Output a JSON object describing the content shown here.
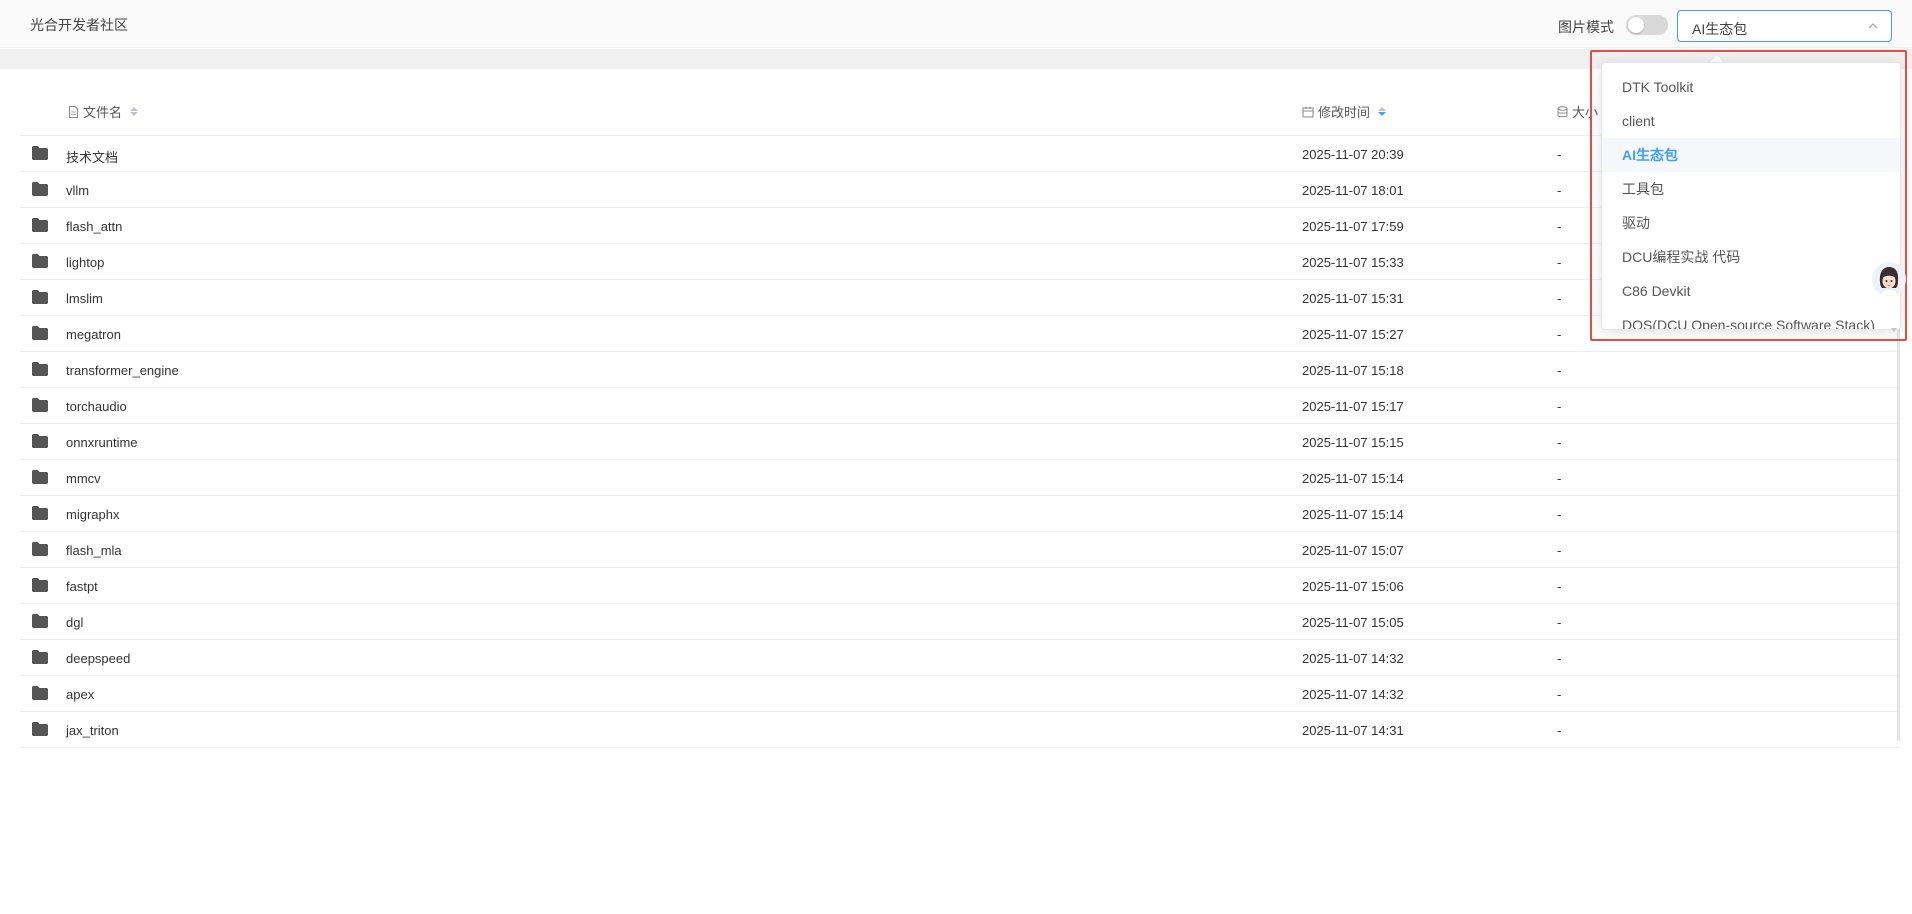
{
  "header": {
    "site_title": "光合开发者社区",
    "picture_mode_label": "图片模式",
    "picture_mode_on": false,
    "selected_category": "AI生态包"
  },
  "table": {
    "columns": {
      "name": "文件名",
      "modified": "修改时间",
      "size": "大小"
    },
    "rows": [
      {
        "name": "技术文档",
        "modified": "2025-11-07 20:39",
        "size": "-"
      },
      {
        "name": "vllm",
        "modified": "2025-11-07 18:01",
        "size": "-"
      },
      {
        "name": "flash_attn",
        "modified": "2025-11-07 17:59",
        "size": "-"
      },
      {
        "name": "lightop",
        "modified": "2025-11-07 15:33",
        "size": "-"
      },
      {
        "name": "lmslim",
        "modified": "2025-11-07 15:31",
        "size": "-"
      },
      {
        "name": "megatron",
        "modified": "2025-11-07 15:27",
        "size": "-"
      },
      {
        "name": "transformer_engine",
        "modified": "2025-11-07 15:18",
        "size": "-"
      },
      {
        "name": "torchaudio",
        "modified": "2025-11-07 15:17",
        "size": "-"
      },
      {
        "name": "onnxruntime",
        "modified": "2025-11-07 15:15",
        "size": "-"
      },
      {
        "name": "mmcv",
        "modified": "2025-11-07 15:14",
        "size": "-"
      },
      {
        "name": "migraphx",
        "modified": "2025-11-07 15:14",
        "size": "-"
      },
      {
        "name": "flash_mla",
        "modified": "2025-11-07 15:07",
        "size": "-"
      },
      {
        "name": "fastpt",
        "modified": "2025-11-07 15:06",
        "size": "-"
      },
      {
        "name": "dgl",
        "modified": "2025-11-07 15:05",
        "size": "-"
      },
      {
        "name": "deepspeed",
        "modified": "2025-11-07 14:32",
        "size": "-"
      },
      {
        "name": "apex",
        "modified": "2025-11-07 14:32",
        "size": "-"
      },
      {
        "name": "jax_triton",
        "modified": "2025-11-07 14:31",
        "size": "-"
      }
    ]
  },
  "dropdown": {
    "options": [
      "DTK Toolkit",
      "client",
      "AI生态包",
      "工具包",
      "驱动",
      "DCU编程实战 代码",
      "C86 Devkit",
      "DOS(DCU Open-source Software Stack)"
    ],
    "selected_index": 2
  },
  "colors": {
    "accent": "#409eff",
    "highlight_box": "#e54d42",
    "folder_icon": "#555555"
  }
}
